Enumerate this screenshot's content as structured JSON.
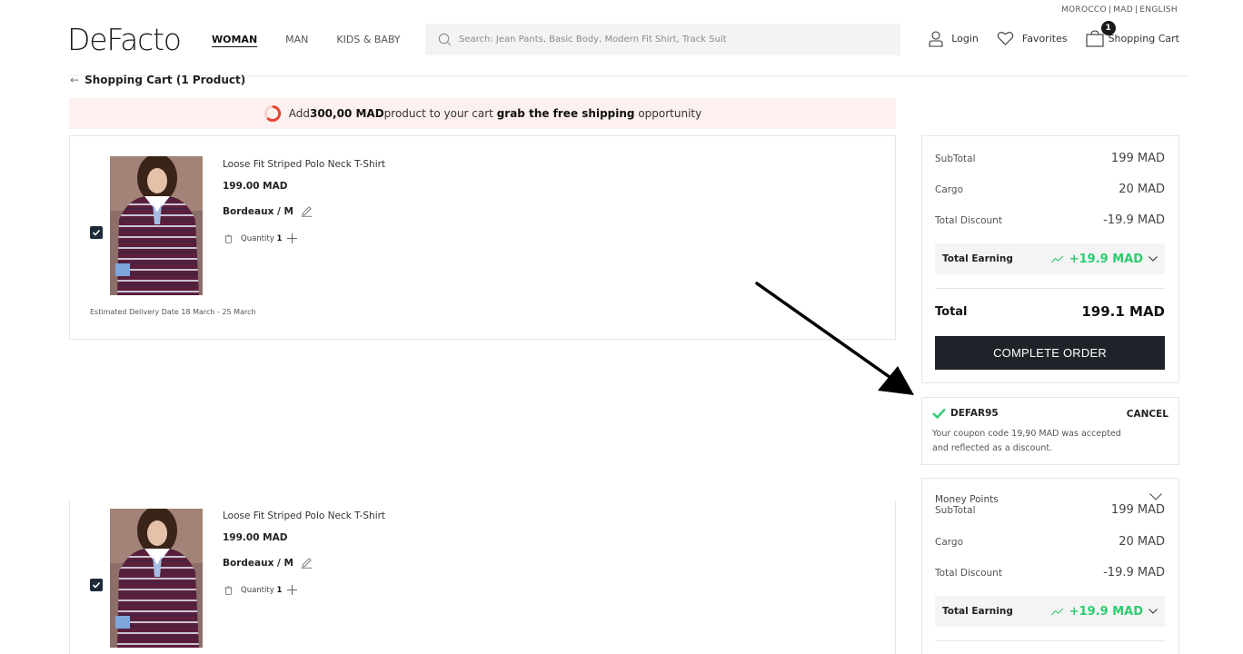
{
  "topbar": {
    "country": "MOROCCO",
    "currency": "MAD",
    "language": "ENGLISH"
  },
  "header": {
    "logo": "DeFacto",
    "nav": [
      "WOMAN",
      "MAN",
      "KIDS & BABY"
    ],
    "search_placeholder": "Search: Jean Pants, Basic Body, Modern Fit Shirt, Track Suit",
    "login": "Login",
    "favorites": "Favorites",
    "cart": "Shopping Cart",
    "cart_count": "1"
  },
  "page": {
    "back_title": "Shopping Cart (1 Product)"
  },
  "banner": {
    "prefix": "Add",
    "amount": "300,00 MAD",
    "middle": "product to your cart ",
    "bold": "grab the free shipping",
    "suffix": " opportunity"
  },
  "product": {
    "name": "Loose Fit Striped Polo Neck T-Shirt",
    "price": "199.00 MAD",
    "variant": "Bordeaux / M",
    "quantity_label": "Quantity",
    "quantity": "1",
    "delivery": "Estimated Delivery Date  18 March - 25 March"
  },
  "summary": {
    "subtotal_label": "SubTotal",
    "subtotal": "199 MAD",
    "cargo_label": "Cargo",
    "cargo": "20 MAD",
    "discount_label": "Total Discount",
    "discount": "-19.9 MAD",
    "earning_label": "Total Earning",
    "earning": "+19.9 MAD",
    "total_label": "Total",
    "total": "199.1 MAD",
    "complete_label": "COMPLETE ORDER"
  },
  "coupon": {
    "code": "DEFAR95",
    "cancel": "CANCEL",
    "message": "Your coupon code 19,90 MAD was accepted and reflected as a discount."
  },
  "money_points": {
    "label": "Money Points"
  },
  "colors": {
    "accent_green": "#2ecc71",
    "dark_button": "#1f2228",
    "banner_bg": "#fdf1ef"
  }
}
